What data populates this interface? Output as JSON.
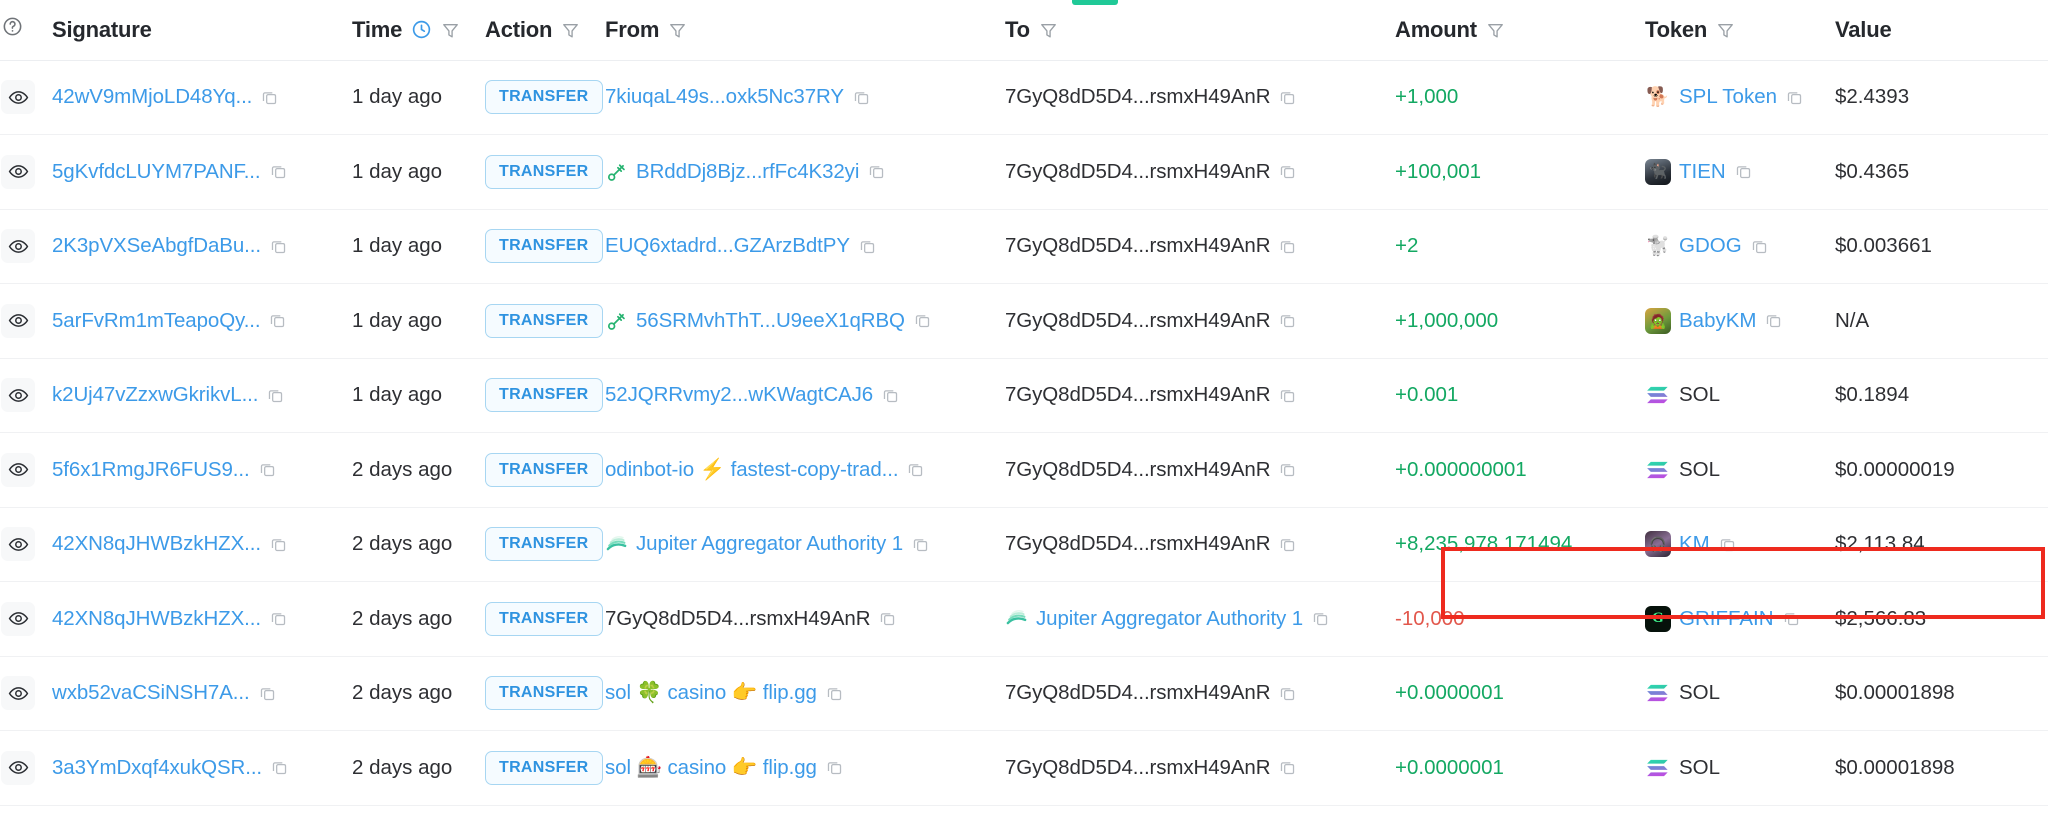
{
  "table": {
    "columns": [
      {
        "key": "eye",
        "label": "",
        "icon": "help-circle-icon",
        "filter": false
      },
      {
        "key": "signature",
        "label": "Signature",
        "filter": false
      },
      {
        "key": "time",
        "label": "Time",
        "filter": true,
        "clock": true
      },
      {
        "key": "action",
        "label": "Action",
        "filter": true
      },
      {
        "key": "from",
        "label": "From",
        "filter": true
      },
      {
        "key": "to",
        "label": "To",
        "filter": true
      },
      {
        "key": "amount",
        "label": "Amount",
        "filter": true
      },
      {
        "key": "token",
        "label": "Token",
        "filter": true
      },
      {
        "key": "value",
        "label": "Value",
        "filter": false
      }
    ],
    "rows": [
      {
        "signature": "42wV9mMjoLD48Yq...",
        "time": "1 day ago",
        "action": "TRANSFER",
        "from": "7kiuqaL49s...oxk5Nc37RY",
        "from_icon": "",
        "from_link": true,
        "to": "7GyQ8dD5D4...rsmxH49AnR",
        "to_icon": "",
        "to_link": false,
        "amount": "+1,000",
        "amount_sign": "positive",
        "token": "SPL Token",
        "token_icon": "dog-emoji",
        "token_copy": true,
        "value": "$2.4393"
      },
      {
        "signature": "5gKvfdcLUYM7PANF...",
        "time": "1 day ago",
        "action": "TRANSFER",
        "from": "BRddDj8Bjz...rfFc4K32yi",
        "from_icon": "green-key-icon",
        "from_link": true,
        "to": "7GyQ8dD5D4...rsmxH49AnR",
        "to_icon": "",
        "to_link": false,
        "amount": "+100,001",
        "amount_sign": "positive",
        "token": "TIEN",
        "token_icon": "tien-avatar",
        "token_copy": true,
        "value": "$0.4365"
      },
      {
        "signature": "2K3pVXSeAbgfDaBu...",
        "time": "1 day ago",
        "action": "TRANSFER",
        "from": "EUQ6xtadrd...GZArzBdtPY",
        "from_icon": "",
        "from_link": true,
        "to": "7GyQ8dD5D4...rsmxH49AnR",
        "to_icon": "",
        "to_link": false,
        "amount": "+2",
        "amount_sign": "positive",
        "token": "GDOG",
        "token_icon": "puppy-emoji",
        "token_copy": true,
        "value": "$0.003661"
      },
      {
        "signature": "5arFvRm1mTeapoQy...",
        "time": "1 day ago",
        "action": "TRANSFER",
        "from": "56SRMvhThT...U9eeX1qRBQ",
        "from_icon": "green-key-icon",
        "from_link": true,
        "to": "7GyQ8dD5D4...rsmxH49AnR",
        "to_icon": "",
        "to_link": false,
        "amount": "+1,000,000",
        "amount_sign": "positive",
        "token": "BabyKM",
        "token_icon": "babykm-avatar",
        "token_copy": true,
        "value": "N/A"
      },
      {
        "signature": "k2Uj47vZzxwGkrikvL...",
        "time": "1 day ago",
        "action": "TRANSFER",
        "from": "52JQRRvmy2...wKWagtCAJ6",
        "from_icon": "",
        "from_link": true,
        "to": "7GyQ8dD5D4...rsmxH49AnR",
        "to_icon": "",
        "to_link": false,
        "amount": "+0.001",
        "amount_sign": "positive",
        "token": "SOL",
        "token_icon": "solana-logo",
        "token_copy": false,
        "value": "$0.1894"
      },
      {
        "signature": "5f6x1RmgJR6FUS9...",
        "time": "2 days ago",
        "action": "TRANSFER",
        "from": "odinbot-io ⚡ fastest-copy-trad...",
        "from_icon": "",
        "from_link": true,
        "to": "7GyQ8dD5D4...rsmxH49AnR",
        "to_icon": "",
        "to_link": false,
        "amount": "+0.000000001",
        "amount_sign": "positive",
        "token": "SOL",
        "token_icon": "solana-logo",
        "token_copy": false,
        "value": "$0.00000019"
      },
      {
        "signature": "42XN8qJHWBzkHZX...",
        "time": "2 days ago",
        "action": "TRANSFER",
        "from": "Jupiter Aggregator Authority 1",
        "from_icon": "jupiter-logo",
        "from_link": true,
        "to": "7GyQ8dD5D4...rsmxH49AnR",
        "to_icon": "",
        "to_link": false,
        "amount": "+8,235,978.171494",
        "amount_sign": "positive",
        "token": "KM",
        "token_icon": "km-avatar",
        "token_copy": true,
        "value": "$2,113.84",
        "highlighted": true
      },
      {
        "signature": "42XN8qJHWBzkHZX...",
        "time": "2 days ago",
        "action": "TRANSFER",
        "from": "7GyQ8dD5D4...rsmxH49AnR",
        "from_icon": "",
        "from_link": false,
        "to": "Jupiter Aggregator Authority 1",
        "to_icon": "jupiter-logo",
        "to_link": true,
        "amount": "-10,000",
        "amount_sign": "negative",
        "token": "GRIFFAIN",
        "token_icon": "griffain-avatar",
        "token_copy": true,
        "value": "$2,566.83"
      },
      {
        "signature": "wxb52vaCSiNSH7A...",
        "time": "2 days ago",
        "action": "TRANSFER",
        "from": "sol 🍀 casino 👉 flip.gg",
        "from_icon": "",
        "from_link": true,
        "to": "7GyQ8dD5D4...rsmxH49AnR",
        "to_icon": "",
        "to_link": false,
        "amount": "+0.0000001",
        "amount_sign": "positive",
        "token": "SOL",
        "token_icon": "solana-logo",
        "token_copy": false,
        "value": "$0.00001898"
      },
      {
        "signature": "3a3YmDxqf4xukQSR...",
        "time": "2 days ago",
        "action": "TRANSFER",
        "from": "sol 🎰 casino 👉 flip.gg",
        "from_icon": "",
        "from_link": true,
        "to": "7GyQ8dD5D4...rsmxH49AnR",
        "to_icon": "",
        "to_link": false,
        "amount": "+0.0000001",
        "amount_sign": "positive",
        "token": "SOL",
        "token_icon": "solana-logo",
        "token_copy": false,
        "value": "$0.00001898"
      }
    ]
  },
  "colors": {
    "link": "#3c9ae8",
    "positive": "#13a862",
    "negative": "#e2574c",
    "badge_text": "#2f93e0",
    "highlight_border": "#ee2a1e",
    "accent_green": "#20c997"
  }
}
